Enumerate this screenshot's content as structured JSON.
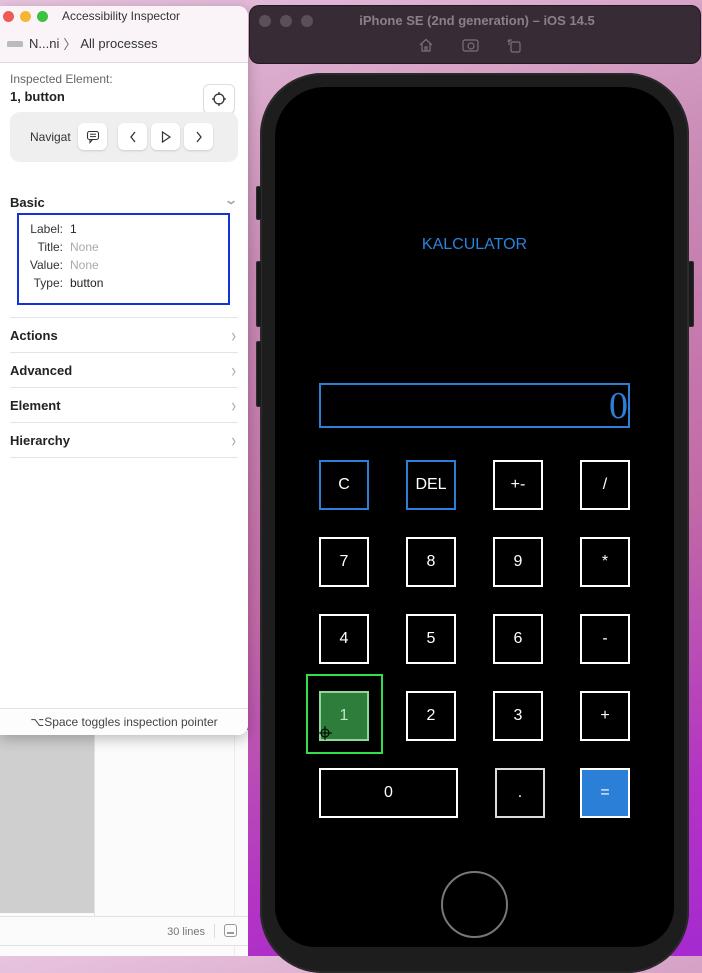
{
  "inspector": {
    "window_title": "Accessibility Inspector",
    "breadcrumb": {
      "device": "N...ni",
      "separator": "〉",
      "target": "All processes"
    },
    "inspected_label": "Inspected Element:",
    "inspected_value": "1, button",
    "navigation": {
      "label": "Navigat",
      "buttons": [
        "speech-bubble-icon",
        "chevron-left-icon",
        "play-icon",
        "chevron-right-icon"
      ]
    },
    "basic": {
      "title": "Basic",
      "properties": [
        {
          "key": "Label:",
          "value": "1",
          "muted": false
        },
        {
          "key": "Title:",
          "value": "None",
          "muted": true
        },
        {
          "key": "Value:",
          "value": "None",
          "muted": true
        },
        {
          "key": "Type:",
          "value": "button",
          "muted": false
        }
      ]
    },
    "sections": [
      "Actions",
      "Advanced",
      "Element",
      "Hierarchy"
    ],
    "footer_hint": "⌥Space toggles inspection pointer"
  },
  "background_app": {
    "line_count": "30 lines"
  },
  "simulator": {
    "title": "iPhone SE (2nd generation) – iOS 14.5",
    "toolbar": [
      "home-icon",
      "screenshot-icon",
      "rotate-icon"
    ]
  },
  "calculator": {
    "title": "KALCULATOR",
    "display_value": "0",
    "keys": {
      "row1": [
        "C",
        "DEL",
        "+-",
        "/"
      ],
      "row2": [
        "7",
        "8",
        "9",
        "*"
      ],
      "row3": [
        "4",
        "5",
        "6",
        "-"
      ],
      "row4": [
        "1",
        "2",
        "3",
        "+"
      ],
      "row5": [
        "0",
        ".",
        "="
      ]
    },
    "highlighted_key": "1",
    "accent_color": "#2b7fd6",
    "highlight_color": "#2fe04a"
  }
}
